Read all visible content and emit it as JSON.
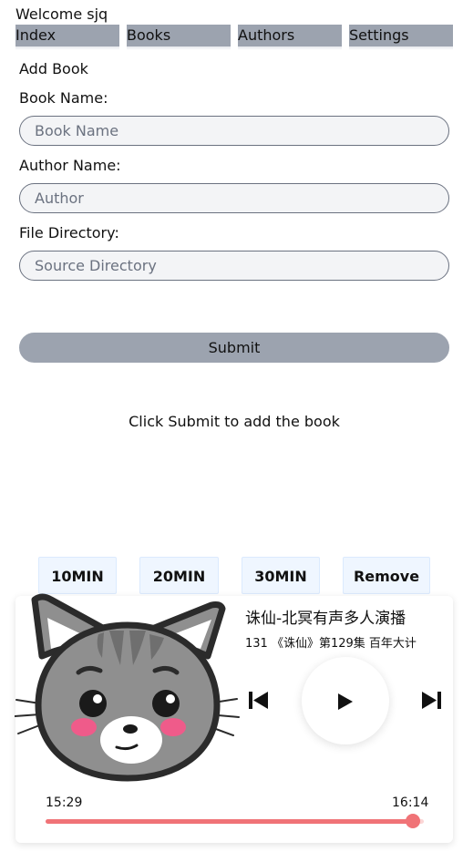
{
  "header": {
    "welcome": "Welcome sjq"
  },
  "nav": {
    "items": [
      {
        "label": "Index"
      },
      {
        "label": "Books"
      },
      {
        "label": "Authors"
      },
      {
        "label": "Settings"
      }
    ]
  },
  "form": {
    "title": "Add Book",
    "book_name_label": "Book Name:",
    "book_name_placeholder": "Book Name",
    "book_name_value": "",
    "author_label": "Author Name:",
    "author_placeholder": "Author",
    "author_value": "",
    "directory_label": "File Directory:",
    "directory_placeholder": "Source Directory",
    "directory_value": "",
    "submit_label": "Submit",
    "hint": "Click Submit to add the book"
  },
  "timer": {
    "buttons": [
      "10MIN",
      "20MIN",
      "30MIN",
      "Remove"
    ]
  },
  "player": {
    "title": "诛仙-北冥有声多人演播",
    "subtitle": "131 《诛仙》第129集 百年大计",
    "current_time": "15:29",
    "total_time": "16:14",
    "progress": 0.97,
    "cover_icon": "cat-face-icon",
    "accent_color": "#f07377"
  }
}
